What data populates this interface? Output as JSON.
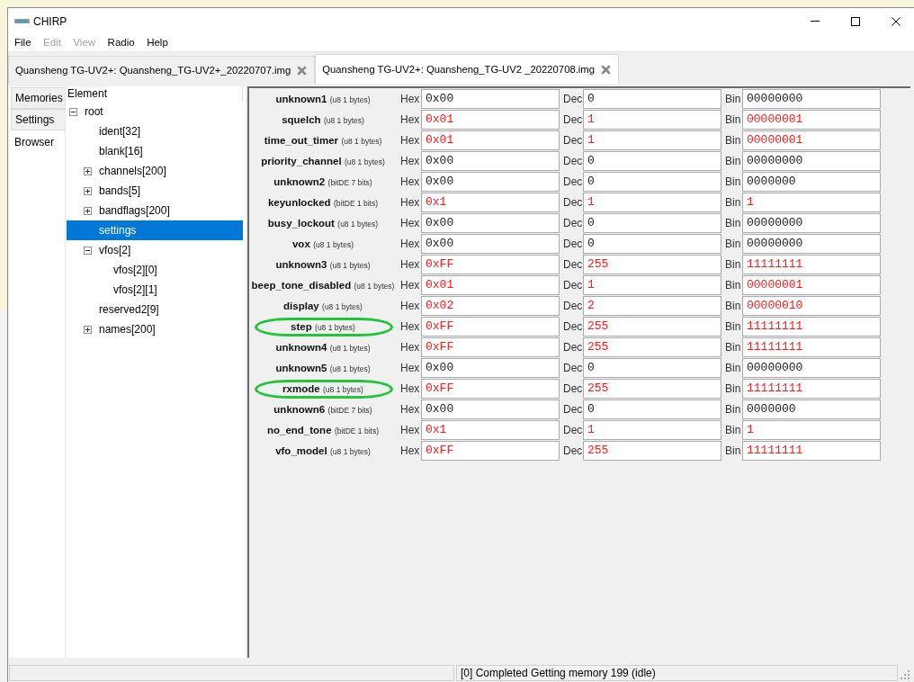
{
  "window": {
    "title": "CHIRP"
  },
  "menu": [
    {
      "label": "File",
      "disabled": false
    },
    {
      "label": "Edit",
      "disabled": true
    },
    {
      "label": "View",
      "disabled": true
    },
    {
      "label": "Radio",
      "disabled": false
    },
    {
      "label": "Help",
      "disabled": false
    }
  ],
  "file_tabs": [
    {
      "label": "Quansheng TG-UV2+: Quansheng_TG-UV2+_20220707.img",
      "selected": false
    },
    {
      "label": "Quansheng TG-UV2+: Quansheng_TG-UV2 _20220708.img",
      "selected": true
    }
  ],
  "side_tabs": [
    {
      "label": "Memories",
      "selected": false
    },
    {
      "label": "Settings",
      "selected": false
    },
    {
      "label": "Browser",
      "selected": true
    }
  ],
  "tree": {
    "header": "Element",
    "items": [
      {
        "label": "root",
        "kind": "branch",
        "expanded": true,
        "selected": false,
        "children": [
          {
            "label": "ident[32]",
            "kind": "leaf",
            "selected": false
          },
          {
            "label": "blank[16]",
            "kind": "leaf",
            "selected": false
          },
          {
            "label": "channels[200]",
            "kind": "branch",
            "expanded": false,
            "selected": false
          },
          {
            "label": "bands[5]",
            "kind": "branch",
            "expanded": false,
            "selected": false
          },
          {
            "label": "bandflags[200]",
            "kind": "branch",
            "expanded": false,
            "selected": false
          },
          {
            "label": "settings",
            "kind": "leaf",
            "selected": true
          },
          {
            "label": "vfos[2]",
            "kind": "branch",
            "expanded": true,
            "selected": false,
            "children": [
              {
                "label": "vfos[2][0]",
                "kind": "leaf",
                "selected": false
              },
              {
                "label": "vfos[2][1]",
                "kind": "leaf",
                "selected": false
              }
            ]
          },
          {
            "label": "reserved2[9]",
            "kind": "leaf",
            "selected": false
          },
          {
            "label": "names[200]",
            "kind": "branch",
            "expanded": false,
            "selected": false
          }
        ]
      }
    ]
  },
  "fields": [
    {
      "name": "unknown1",
      "type": "(u8 1 bytes)",
      "highlighted": false,
      "circled": false,
      "values": [
        {
          "label": "Hex",
          "value": "0x00"
        },
        {
          "label": "Dec",
          "value": "0"
        },
        {
          "label": "Bin",
          "value": "00000000"
        }
      ]
    },
    {
      "name": "squelch",
      "type": "(u8 1 bytes)",
      "highlighted": true,
      "circled": false,
      "values": [
        {
          "label": "Hex",
          "value": "0x01"
        },
        {
          "label": "Dec",
          "value": "1"
        },
        {
          "label": "Bin",
          "value": "00000001"
        }
      ]
    },
    {
      "name": "time_out_timer",
      "type": "(u8 1 bytes)",
      "highlighted": true,
      "circled": false,
      "values": [
        {
          "label": "Hex",
          "value": "0x01"
        },
        {
          "label": "Dec",
          "value": "1"
        },
        {
          "label": "Bin",
          "value": "00000001"
        }
      ]
    },
    {
      "name": "priority_channel",
      "type": "(u8 1 bytes)",
      "highlighted": false,
      "circled": false,
      "values": [
        {
          "label": "Hex",
          "value": "0x00"
        },
        {
          "label": "Dec",
          "value": "0"
        },
        {
          "label": "Bin",
          "value": "00000000"
        }
      ]
    },
    {
      "name": "unknown2",
      "type": "(bitDE 7 bits)",
      "highlighted": false,
      "circled": false,
      "values": [
        {
          "label": "Hex",
          "value": "0x00"
        },
        {
          "label": "Dec",
          "value": "0"
        },
        {
          "label": "Bin",
          "value": "0000000"
        }
      ]
    },
    {
      "name": "keyunlocked",
      "type": "(bitDE 1 bits)",
      "highlighted": true,
      "circled": false,
      "values": [
        {
          "label": "Hex",
          "value": "0x1"
        },
        {
          "label": "Dec",
          "value": "1"
        },
        {
          "label": "Bin",
          "value": "1"
        }
      ]
    },
    {
      "name": "busy_lockout",
      "type": "(u8 1 bytes)",
      "highlighted": false,
      "circled": false,
      "values": [
        {
          "label": "Hex",
          "value": "0x00"
        },
        {
          "label": "Dec",
          "value": "0"
        },
        {
          "label": "Bin",
          "value": "00000000"
        }
      ]
    },
    {
      "name": "vox",
      "type": "(u8 1 bytes)",
      "highlighted": false,
      "circled": false,
      "values": [
        {
          "label": "Hex",
          "value": "0x00"
        },
        {
          "label": "Dec",
          "value": "0"
        },
        {
          "label": "Bin",
          "value": "00000000"
        }
      ]
    },
    {
      "name": "unknown3",
      "type": "(u8 1 bytes)",
      "highlighted": true,
      "circled": false,
      "values": [
        {
          "label": "Hex",
          "value": "0xFF"
        },
        {
          "label": "Dec",
          "value": "255"
        },
        {
          "label": "Bin",
          "value": "11111111"
        }
      ]
    },
    {
      "name": "beep_tone_disabled",
      "type": "(u8 1 bytes)",
      "highlighted": true,
      "circled": false,
      "values": [
        {
          "label": "Hex",
          "value": "0x01"
        },
        {
          "label": "Dec",
          "value": "1"
        },
        {
          "label": "Bin",
          "value": "00000001"
        }
      ]
    },
    {
      "name": "display",
      "type": "(u8 1 bytes)",
      "highlighted": true,
      "circled": false,
      "values": [
        {
          "label": "Hex",
          "value": "0x02"
        },
        {
          "label": "Dec",
          "value": "2"
        },
        {
          "label": "Bin",
          "value": "00000010"
        }
      ]
    },
    {
      "name": "step",
      "type": "(u8 1 bytes)",
      "highlighted": true,
      "circled": true,
      "values": [
        {
          "label": "Hex",
          "value": "0xFF"
        },
        {
          "label": "Dec",
          "value": "255"
        },
        {
          "label": "Bin",
          "value": "11111111"
        }
      ]
    },
    {
      "name": "unknown4",
      "type": "(u8 1 bytes)",
      "highlighted": true,
      "circled": false,
      "values": [
        {
          "label": "Hex",
          "value": "0xFF"
        },
        {
          "label": "Dec",
          "value": "255"
        },
        {
          "label": "Bin",
          "value": "11111111"
        }
      ]
    },
    {
      "name": "unknown5",
      "type": "(u8 1 bytes)",
      "highlighted": false,
      "circled": false,
      "values": [
        {
          "label": "Hex",
          "value": "0x00"
        },
        {
          "label": "Dec",
          "value": "0"
        },
        {
          "label": "Bin",
          "value": "00000000"
        }
      ]
    },
    {
      "name": "rxmode",
      "type": "(u8 1 bytes)",
      "highlighted": true,
      "circled": true,
      "values": [
        {
          "label": "Hex",
          "value": "0xFF"
        },
        {
          "label": "Dec",
          "value": "255"
        },
        {
          "label": "Bin",
          "value": "11111111"
        }
      ]
    },
    {
      "name": "unknown6",
      "type": "(bitDE 7 bits)",
      "highlighted": false,
      "circled": false,
      "values": [
        {
          "label": "Hex",
          "value": "0x00"
        },
        {
          "label": "Dec",
          "value": "0"
        },
        {
          "label": "Bin",
          "value": "0000000"
        }
      ]
    },
    {
      "name": "no_end_tone",
      "type": "(bitDE 1 bits)",
      "highlighted": true,
      "circled": false,
      "values": [
        {
          "label": "Hex",
          "value": "0x1"
        },
        {
          "label": "Dec",
          "value": "1"
        },
        {
          "label": "Bin",
          "value": "1"
        }
      ]
    },
    {
      "name": "vfo_model",
      "type": "(u8 1 bytes)",
      "highlighted": true,
      "circled": false,
      "values": [
        {
          "label": "Hex",
          "value": "0xFF"
        },
        {
          "label": "Dec",
          "value": "255"
        },
        {
          "label": "Bin",
          "value": "11111111"
        }
      ]
    }
  ],
  "status_bar": {
    "message": "[0] Completed Getting memory 199 (idle)"
  }
}
